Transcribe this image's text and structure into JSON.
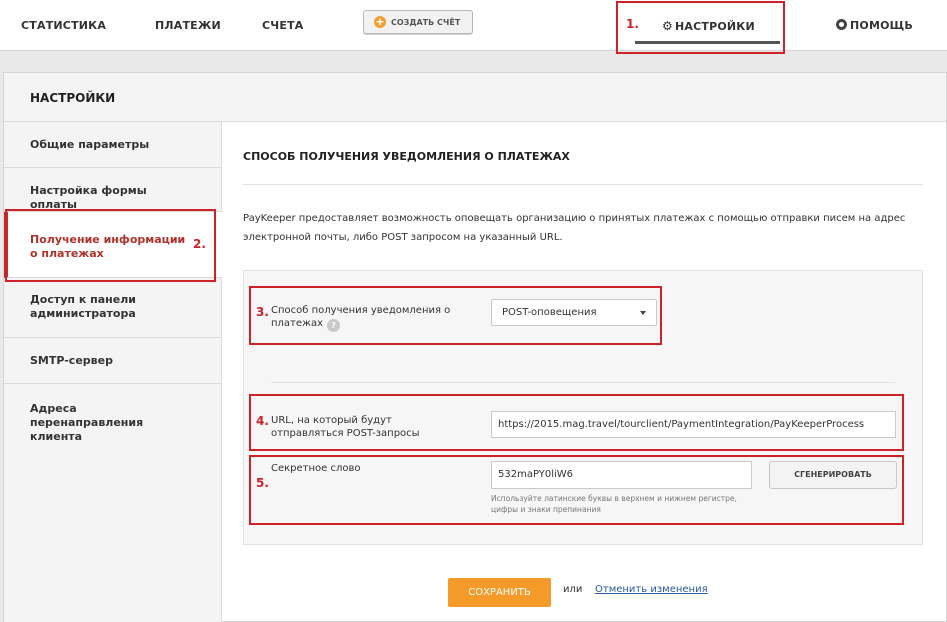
{
  "topnav": {
    "statistics": "СТАТИСТИКА",
    "payments": "ПЛАТЕЖИ",
    "invoices": "СЧЕТА",
    "create_invoice": "СОЗДАТЬ СЧЁТ",
    "settings": "НАСТРОЙКИ",
    "help": "ПОМОЩЬ"
  },
  "panel": {
    "title": "НАСТРОЙКИ"
  },
  "sidebar": {
    "items": [
      {
        "label": "Общие параметры"
      },
      {
        "label": "Настройка формы оплаты"
      },
      {
        "label": "Получение информации о платежах",
        "active": true
      },
      {
        "label": "Доступ к панели администратора"
      },
      {
        "label": "SMTP-сервер"
      },
      {
        "label": "Адреса перенаправления клиента"
      }
    ]
  },
  "content": {
    "title": "СПОСОБ ПОЛУЧЕНИЯ УВЕДОМЛЕНИЯ О ПЛАТЕЖАХ",
    "description": "PayKeeper предоставляет возможность оповещать организацию о принятых платежах с помощью отправки писем на адрес электронной почты, либо POST запросом на указанный URL."
  },
  "form": {
    "method_label": "Способ получения уведомления о платежах",
    "help_mark": "?",
    "method_value": "POST-оповещения",
    "url_label": "URL, на который будут отправляться POST-запросы",
    "url_value": "https://2015.mag.travel/tourclient/PaymentIntegration/PayKeeperProcess",
    "secret_label": "Секретное слово",
    "secret_value": "532maPY0liW6",
    "generate_button": "СГЕНЕРИРОВАТЬ",
    "secret_hint": "Используйте латинские буквы в верхнем и нижнем регистре, цифры и знаки препинания"
  },
  "actions": {
    "save": "СОХРАНИТЬ",
    "or": "или",
    "cancel": "Отменить изменения"
  },
  "annotations": [
    "1.",
    "2.",
    "3.",
    "4.",
    "5."
  ],
  "colors": {
    "accent": "#f39a28",
    "active": "#b0322a",
    "annotation": "#d0202a",
    "link": "#2a5a9a"
  }
}
